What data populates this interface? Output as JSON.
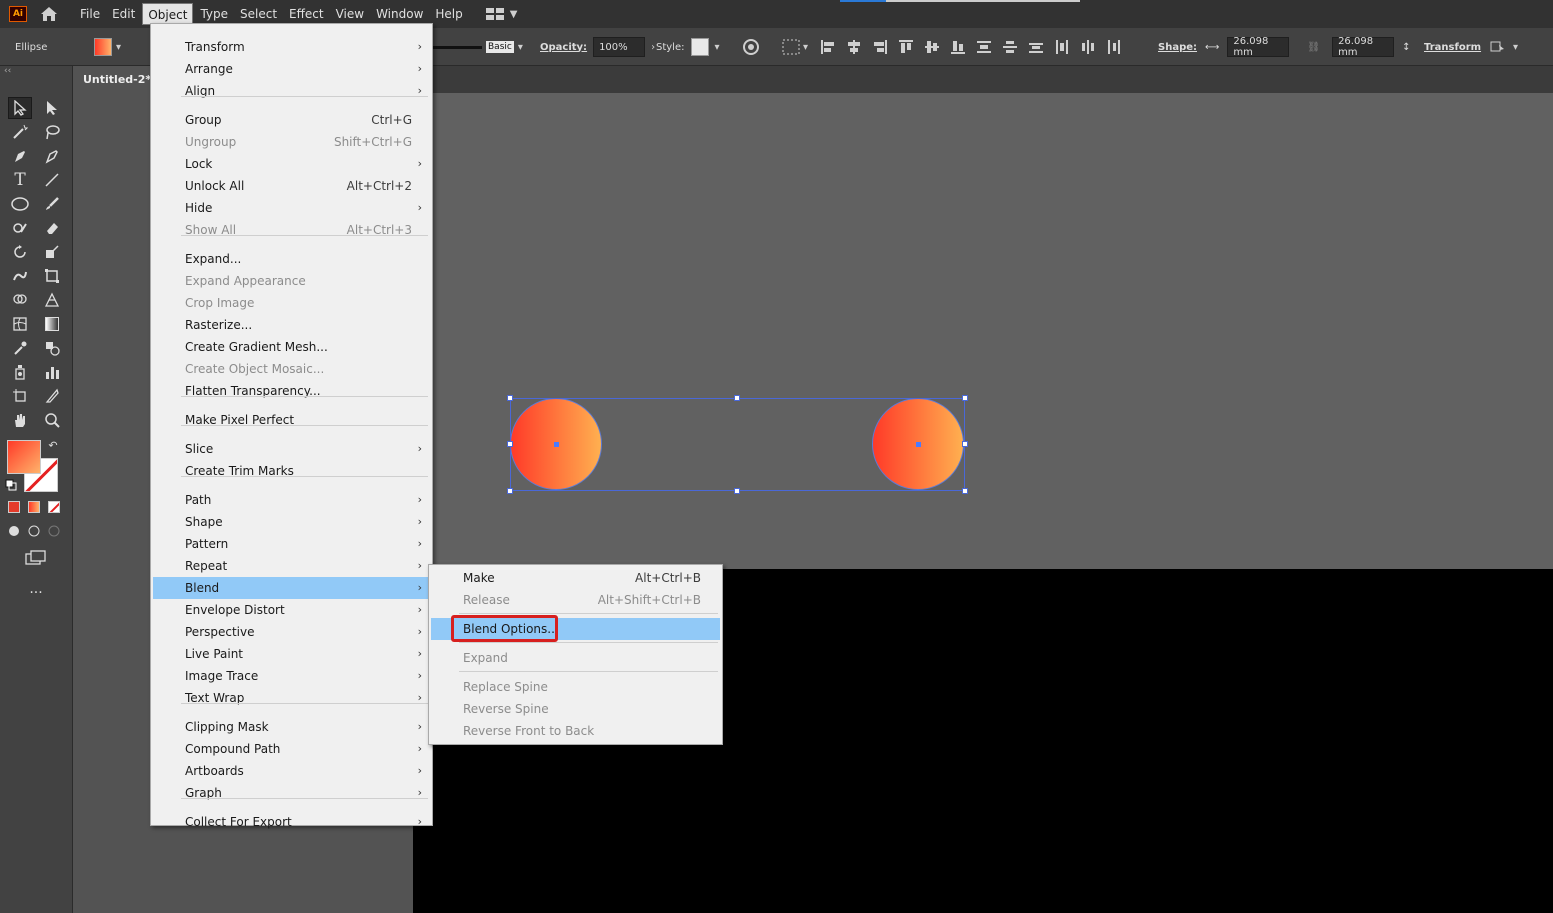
{
  "app": {
    "logo": "Ai"
  },
  "menubar": {
    "items": [
      "File",
      "Edit",
      "Object",
      "Type",
      "Select",
      "Effect",
      "View",
      "Window",
      "Help"
    ],
    "open_item": "Object"
  },
  "controlbar": {
    "selection_type": "Ellipse",
    "stroke_style": "Basic",
    "opacity_label": "Opacity:",
    "opacity_value": "100%",
    "style_label": "Style:",
    "shape_label": "Shape:",
    "width_value": "26.098 mm",
    "height_value": "26.098 mm",
    "transform_label": "Transform"
  },
  "document": {
    "tab_title": "Untitled-2* @"
  },
  "toolbar": {
    "more_label": "..."
  },
  "object_menu": {
    "items": [
      {
        "label": "Transform",
        "shortcut": "",
        "submenu": true,
        "disabled": false
      },
      {
        "label": "Arrange",
        "shortcut": "",
        "submenu": true,
        "disabled": false
      },
      {
        "label": "Align",
        "shortcut": "",
        "submenu": true,
        "disabled": false
      },
      {
        "label": "Group",
        "shortcut": "Ctrl+G",
        "submenu": false,
        "disabled": false
      },
      {
        "label": "Ungroup",
        "shortcut": "Shift+Ctrl+G",
        "submenu": false,
        "disabled": true
      },
      {
        "label": "Lock",
        "shortcut": "",
        "submenu": true,
        "disabled": false
      },
      {
        "label": "Unlock All",
        "shortcut": "Alt+Ctrl+2",
        "submenu": false,
        "disabled": false
      },
      {
        "label": "Hide",
        "shortcut": "",
        "submenu": true,
        "disabled": false
      },
      {
        "label": "Show All",
        "shortcut": "Alt+Ctrl+3",
        "submenu": false,
        "disabled": true
      },
      {
        "label": "Expand...",
        "shortcut": "",
        "submenu": false,
        "disabled": false
      },
      {
        "label": "Expand Appearance",
        "shortcut": "",
        "submenu": false,
        "disabled": true
      },
      {
        "label": "Crop Image",
        "shortcut": "",
        "submenu": false,
        "disabled": true
      },
      {
        "label": "Rasterize...",
        "shortcut": "",
        "submenu": false,
        "disabled": false
      },
      {
        "label": "Create Gradient Mesh...",
        "shortcut": "",
        "submenu": false,
        "disabled": false
      },
      {
        "label": "Create Object Mosaic...",
        "shortcut": "",
        "submenu": false,
        "disabled": true
      },
      {
        "label": "Flatten Transparency...",
        "shortcut": "",
        "submenu": false,
        "disabled": false
      },
      {
        "label": "Make Pixel Perfect",
        "shortcut": "",
        "submenu": false,
        "disabled": false
      },
      {
        "label": "Slice",
        "shortcut": "",
        "submenu": true,
        "disabled": false
      },
      {
        "label": "Create Trim Marks",
        "shortcut": "",
        "submenu": false,
        "disabled": false
      },
      {
        "label": "Path",
        "shortcut": "",
        "submenu": true,
        "disabled": false
      },
      {
        "label": "Shape",
        "shortcut": "",
        "submenu": true,
        "disabled": false
      },
      {
        "label": "Pattern",
        "shortcut": "",
        "submenu": true,
        "disabled": false
      },
      {
        "label": "Repeat",
        "shortcut": "",
        "submenu": true,
        "disabled": false
      },
      {
        "label": "Blend",
        "shortcut": "",
        "submenu": true,
        "disabled": false,
        "highlighted": true
      },
      {
        "label": "Envelope Distort",
        "shortcut": "",
        "submenu": true,
        "disabled": false
      },
      {
        "label": "Perspective",
        "shortcut": "",
        "submenu": true,
        "disabled": false
      },
      {
        "label": "Live Paint",
        "shortcut": "",
        "submenu": true,
        "disabled": false
      },
      {
        "label": "Image Trace",
        "shortcut": "",
        "submenu": true,
        "disabled": false
      },
      {
        "label": "Text Wrap",
        "shortcut": "",
        "submenu": true,
        "disabled": false
      },
      {
        "label": "Clipping Mask",
        "shortcut": "",
        "submenu": true,
        "disabled": false
      },
      {
        "label": "Compound Path",
        "shortcut": "",
        "submenu": true,
        "disabled": false
      },
      {
        "label": "Artboards",
        "shortcut": "",
        "submenu": true,
        "disabled": false
      },
      {
        "label": "Graph",
        "shortcut": "",
        "submenu": true,
        "disabled": false
      },
      {
        "label": "Collect For Export",
        "shortcut": "",
        "submenu": true,
        "disabled": false
      }
    ]
  },
  "blend_menu": {
    "items": [
      {
        "label": "Make",
        "shortcut": "Alt+Ctrl+B",
        "disabled": false
      },
      {
        "label": "Release",
        "shortcut": "Alt+Shift+Ctrl+B",
        "disabled": true
      },
      {
        "label": "Blend Options...",
        "shortcut": "",
        "disabled": false,
        "highlighted": true
      },
      {
        "label": "Expand",
        "shortcut": "",
        "disabled": true
      },
      {
        "label": "Replace Spine",
        "shortcut": "",
        "disabled": true
      },
      {
        "label": "Reverse Spine",
        "shortcut": "",
        "disabled": true
      },
      {
        "label": "Reverse Front to Back",
        "shortcut": "",
        "disabled": true
      }
    ]
  },
  "colors": {
    "menu_highlight": "#91c9f7",
    "annotation_red": "#d7201f",
    "gradient_start": "#ff3a28",
    "gradient_end": "#ffb050",
    "selection_blue": "#4a68d8"
  }
}
